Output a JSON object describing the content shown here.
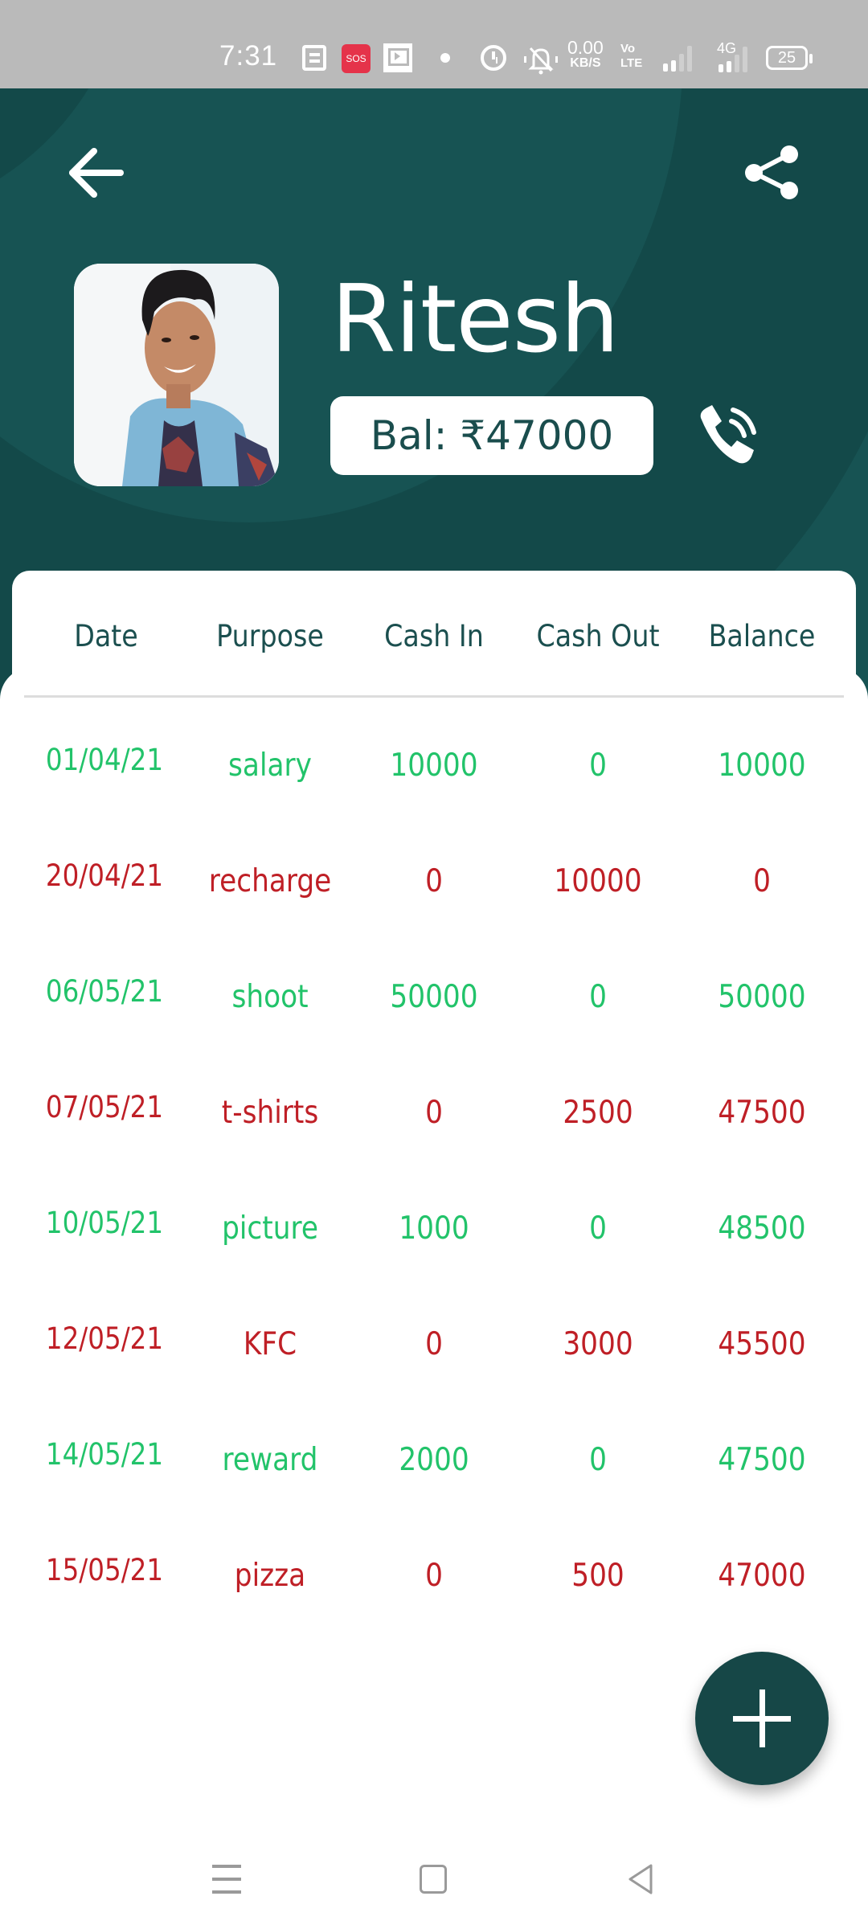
{
  "status_bar": {
    "time": "7:31",
    "sos_label": "SOS",
    "net_speed_value": "0.00",
    "net_speed_unit": "KB/S",
    "volte_line1": "Vo",
    "volte_line2": "LTE",
    "network_type": "4G",
    "battery_level": "25",
    "icons": [
      "news-icon",
      "sos-icon",
      "video-icon",
      "dot-icon",
      "alarm-icon",
      "mute-icon",
      "signal-icon",
      "4g-signal-icon",
      "battery-icon"
    ]
  },
  "header": {
    "back_icon": "arrow-left-icon",
    "share_icon": "share-icon",
    "contact_name": "Ritesh",
    "balance_label": "Bal: ₹47000",
    "call_icon": "phone-call-icon",
    "colors": {
      "background": "#175353",
      "text": "#ffffff",
      "balance_text": "#1a4d4d"
    }
  },
  "table": {
    "columns": [
      "Date",
      "Purpose",
      "Cash In",
      "Cash Out",
      "Balance"
    ],
    "colors": {
      "header": "#1b4f4f",
      "cash_in_row": "#22c36a",
      "cash_out_row": "#bf1f26"
    },
    "rows": [
      {
        "type": "in",
        "date": "01/04/21",
        "purpose": "salary",
        "cash_in": "10000",
        "cash_out": "0",
        "balance": "10000"
      },
      {
        "type": "out",
        "date": "20/04/21",
        "purpose": "recharge",
        "cash_in": "0",
        "cash_out": "10000",
        "balance": "0"
      },
      {
        "type": "in",
        "date": "06/05/21",
        "purpose": "shoot",
        "cash_in": "50000",
        "cash_out": "0",
        "balance": "50000"
      },
      {
        "type": "out",
        "date": "07/05/21",
        "purpose": "t-shirts",
        "cash_in": "0",
        "cash_out": "2500",
        "balance": "47500"
      },
      {
        "type": "in",
        "date": "10/05/21",
        "purpose": "picture",
        "cash_in": "1000",
        "cash_out": "0",
        "balance": "48500"
      },
      {
        "type": "out",
        "date": "12/05/21",
        "purpose": "KFC",
        "cash_in": "0",
        "cash_out": "3000",
        "balance": "45500"
      },
      {
        "type": "in",
        "date": "14/05/21",
        "purpose": "reward",
        "cash_in": "2000",
        "cash_out": "0",
        "balance": "47500"
      },
      {
        "type": "out",
        "date": "15/05/21",
        "purpose": "pizza",
        "cash_in": "0",
        "cash_out": "500",
        "balance": "47000"
      }
    ]
  },
  "fab": {
    "icon": "plus-icon",
    "color": "#164747"
  },
  "nav_bar": {
    "icons": [
      "recents-menu-icon",
      "home-icon",
      "back-triangle-icon"
    ]
  }
}
